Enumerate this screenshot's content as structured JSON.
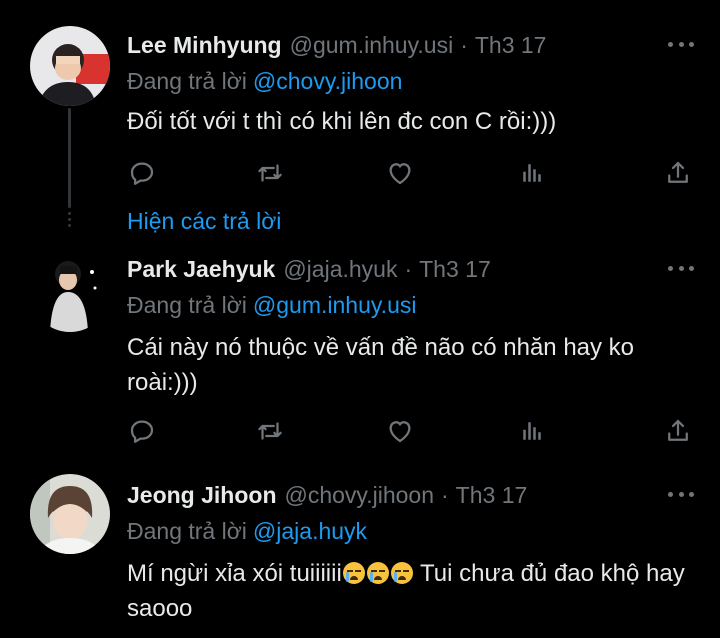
{
  "colors": {
    "background": "#000000",
    "text": "#e7e9ea",
    "muted": "#71767b",
    "accent": "#1d9bf0",
    "thread_line": "#333639"
  },
  "tweets": [
    {
      "name": "Lee Minhyung",
      "handle": "@gum.inhuy.usi",
      "separator": "·",
      "time": "Th3 17",
      "replying_prefix": "Đang trả lời",
      "replying_to": "@chovy.jihoon",
      "text": "Đối tốt với t thì có khi lên đc con C rồi:)))"
    },
    {
      "name": "Park Jaehyuk",
      "handle": "@jaja.hyuk",
      "separator": "·",
      "time": "Th3 17",
      "replying_prefix": "Đang trả lời",
      "replying_to": "@gum.inhuy.usi",
      "text": "Cái này nó thuộc về vấn đề não có nhăn hay ko roài:)))"
    },
    {
      "name": "Jeong Jihoon",
      "handle": "@chovy.jihoon",
      "separator": "·",
      "time": "Th3 17",
      "replying_prefix": "Đang trả lời",
      "replying_to": "@jaja.huyk",
      "text_before": "Mí ngừi xỉa xói tuiiiiii",
      "text_after": " Tui chưa đủ đao khộ hay saooo"
    }
  ],
  "show_replies_label": "Hiện các trả lời",
  "action_icons": [
    "reply-icon",
    "retweet-icon",
    "like-icon",
    "views-icon",
    "share-icon"
  ],
  "emoji": "loudly-crying-face"
}
